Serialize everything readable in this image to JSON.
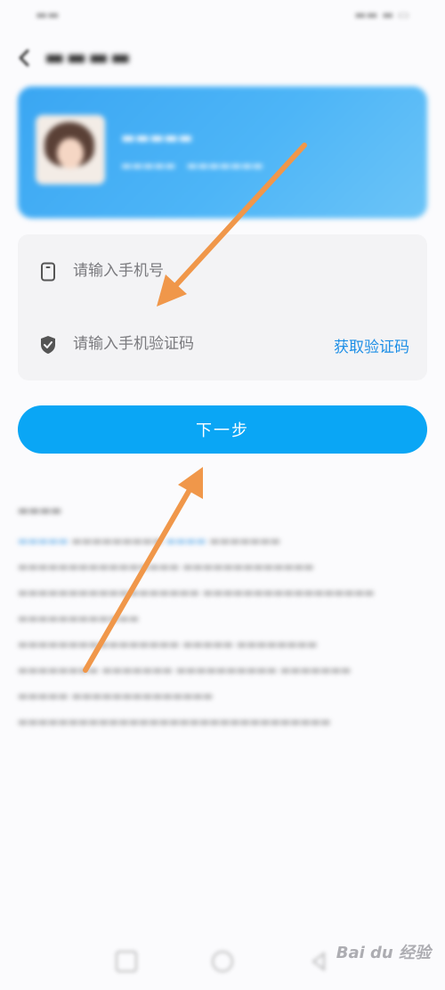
{
  "form": {
    "phone_placeholder": "请输入手机号",
    "code_placeholder": "请输入手机验证码",
    "get_code_label": "获取验证码"
  },
  "next_button_label": "下一步",
  "icons": {
    "back": "back-arrow-icon",
    "phone": "phone-icon",
    "code": "shield-check-icon"
  },
  "watermark_text": "Bai du 经验",
  "colors": {
    "accent": "#0aa6f5",
    "link": "#1e8fe6",
    "card_gradient_start": "#3aa6f2",
    "annotation_arrow": "#f0974a"
  }
}
